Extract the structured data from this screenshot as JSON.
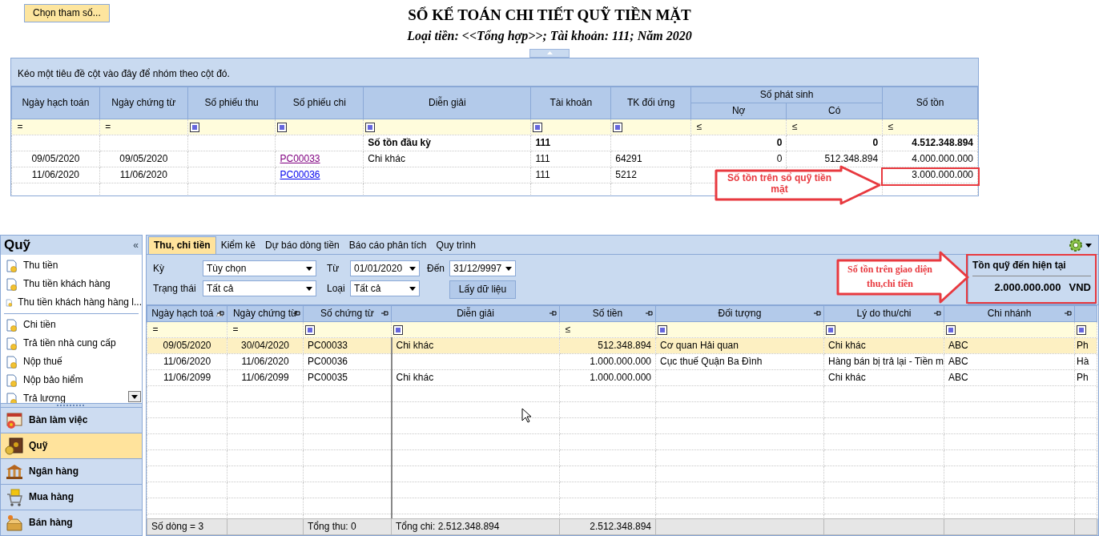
{
  "toolbar": {
    "button": "Chọn tham số..."
  },
  "report": {
    "title": "SỔ KẾ TOÁN CHI TIẾT QUỸ TIỀN MẶT",
    "subtitle": "Loại tiền: <<Tổng hợp>>; Tài khoản: 111; Năm 2020"
  },
  "ledger": {
    "group_hint": "Kéo một tiêu đề cột vào đây để nhóm theo cột đó.",
    "columns": [
      {
        "label": "Ngày hạch toán",
        "filter": {
          "kind": "text",
          "operator": "="
        }
      },
      {
        "label": "Ngày chứng từ",
        "filter": {
          "kind": "text",
          "operator": "="
        }
      },
      {
        "label": "Số phiếu thu",
        "filter": {
          "kind": "check"
        }
      },
      {
        "label": "Số phiếu chi",
        "filter": {
          "kind": "check"
        }
      },
      {
        "label": "Diễn giải",
        "filter": {
          "kind": "check"
        }
      },
      {
        "label": "Tài khoản",
        "filter": {
          "kind": "check"
        }
      },
      {
        "label": "TK đối ứng",
        "filter": {
          "kind": "check"
        }
      },
      {
        "label": "Số phát sinh",
        "colspan": 2,
        "children": [
          {
            "label": "Nợ",
            "filter": {
              "kind": "text",
              "operator": "≤"
            }
          },
          {
            "label": "Có",
            "filter": {
              "kind": "text",
              "operator": "≤"
            }
          }
        ]
      },
      {
        "label": "Số tồn",
        "filter": {
          "kind": "text",
          "operator": "≤"
        }
      }
    ],
    "rows": [
      {
        "kind": "opening",
        "cells": [
          "",
          "",
          "",
          "",
          "Số tồn đầu kỳ",
          "111",
          "",
          "0",
          "0",
          "4.512.348.894"
        ]
      },
      {
        "kind": "entry",
        "visited": true,
        "cells": [
          "09/05/2020",
          "09/05/2020",
          "",
          "PC00033",
          "Chi khác",
          "111",
          "64291",
          "0",
          "512.348.894",
          "4.000.000.000"
        ]
      },
      {
        "kind": "entry",
        "visited": false,
        "cells": [
          "11/06/2020",
          "11/06/2020",
          "",
          "PC00036",
          "",
          "111",
          "5212",
          "",
          "",
          "3.000.000.000"
        ]
      }
    ]
  },
  "callouts": [
    {
      "text": "Số tồn trên sổ quỹ tiền mặt"
    },
    {
      "text": "Số tồn trên giao diện thu,chi tiền"
    }
  ],
  "sidebar": {
    "title": "Quỹ",
    "collapse": "«",
    "groups": [
      {
        "items": [
          {
            "label": "Thu tiền"
          },
          {
            "label": "Thu tiền khách hàng"
          },
          {
            "label": "Thu tiền khách hàng hàng l..."
          }
        ]
      },
      {
        "items": [
          {
            "label": "Chi tiền"
          },
          {
            "label": "Trả tiền nhà cung cấp"
          },
          {
            "label": "Nộp thuế"
          },
          {
            "label": "Nộp bảo hiểm"
          },
          {
            "label": "Trả lương"
          }
        ]
      }
    ],
    "nav": [
      {
        "label": "Bàn làm việc",
        "selected": false
      },
      {
        "label": "Quỹ",
        "selected": true
      },
      {
        "label": "Ngân hàng",
        "selected": false
      },
      {
        "label": "Mua hàng",
        "selected": false
      },
      {
        "label": "Bán hàng",
        "selected": false
      }
    ]
  },
  "tabs": [
    {
      "label": "Thu, chi tiền",
      "selected": true
    },
    {
      "label": "Kiểm kê",
      "selected": false
    },
    {
      "label": "Dự báo dòng tiền",
      "selected": false
    },
    {
      "label": "Báo cáo phân tích",
      "selected": false
    },
    {
      "label": "Quy trình",
      "selected": false
    }
  ],
  "filters": {
    "period": {
      "label": "Kỳ",
      "value": "Tùy chọn"
    },
    "status": {
      "label": "Trạng thái",
      "value": "Tất cả"
    },
    "from": {
      "label": "Từ",
      "value": "01/01/2020"
    },
    "type": {
      "label": "Loại",
      "value": "Tất cả"
    },
    "to": {
      "label": "Đến",
      "value": "31/12/9997"
    },
    "fetch_button": "Lấy dữ liệu"
  },
  "balance": {
    "label": "Tồn quỹ đến hiện tại",
    "amount": "2.000.000.000",
    "currency": "VND"
  },
  "grid": {
    "columns": [
      {
        "label": "Ngày hạch toá",
        "sorted": true,
        "filter": {
          "kind": "text",
          "operator": "="
        }
      },
      {
        "label": "Ngày chứng từ",
        "sorted": false,
        "filter": {
          "kind": "text",
          "operator": "="
        }
      },
      {
        "label": "Số chứng từ",
        "sorted": false,
        "filter": {
          "kind": "check"
        }
      },
      {
        "label": "Diễn giải",
        "sorted": false,
        "filter": {
          "kind": "check"
        }
      },
      {
        "label": "Số tiền",
        "sorted": false,
        "filter": {
          "kind": "text",
          "operator": "≤"
        }
      },
      {
        "label": "Đối tượng",
        "sorted": false,
        "filter": {
          "kind": "check"
        }
      },
      {
        "label": "Lý do thu/chi",
        "sorted": false,
        "filter": {
          "kind": "check"
        }
      },
      {
        "label": "Chi nhánh",
        "sorted": false,
        "filter": {
          "kind": "check"
        }
      },
      {
        "sorted": false,
        "filter": {
          "kind": "check"
        }
      }
    ],
    "rows": [
      {
        "selected": true,
        "cells": [
          "09/05/2020",
          "30/04/2020",
          "PC00033",
          "Chi khác",
          "512.348.894",
          "Cơ quan Hải quan",
          "Chi khác",
          "ABC",
          "Ph"
        ]
      },
      {
        "selected": false,
        "cells": [
          "11/06/2020",
          "11/06/2020",
          "PC00036",
          "",
          "1.000.000.000",
          "Cục thuế Quận Ba Đình",
          "Hàng bán bị trả lại - Tiền m",
          "ABC",
          "Hà"
        ]
      },
      {
        "selected": false,
        "cells": [
          "11/06/2099",
          "11/06/2099",
          "PC00035",
          "Chi khác",
          "1.000.000.000",
          "",
          "Chi khác",
          "ABC",
          "Ph"
        ]
      }
    ],
    "footer": {
      "row_count": "Số dòng = 3",
      "total_in": "Tổng thu: 0",
      "total_out": "Tổng chi: 2.512.348.894",
      "amount_total": "2.512.348.894"
    }
  }
}
